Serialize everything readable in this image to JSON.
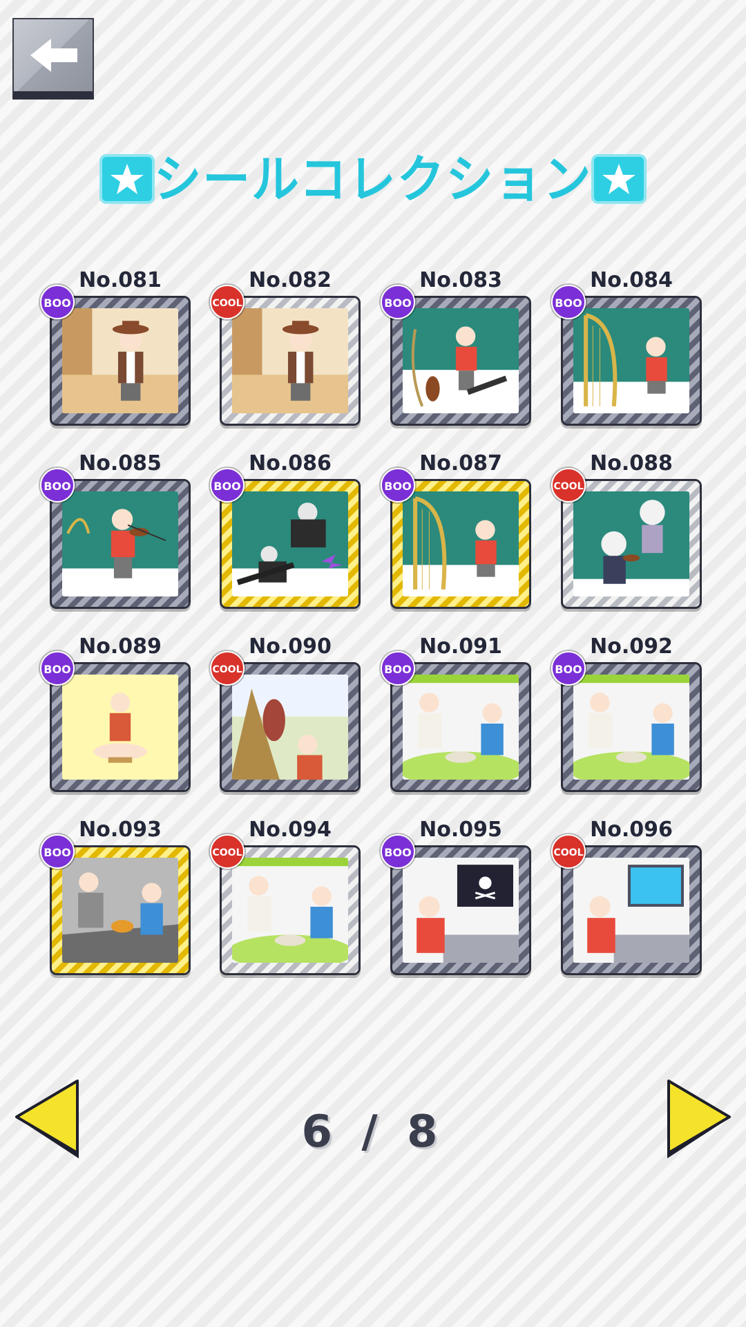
{
  "title": "シールコレクション",
  "icons": {
    "back": "back-arrow-icon",
    "title_deco": "star-sticker-icon",
    "prev": "triangle-left-icon",
    "next": "triangle-right-icon"
  },
  "colors": {
    "title": "#25c6dc",
    "boo_badge": "#7b2fd6",
    "cool_badge": "#d8322a",
    "arrow": "#f4e32a"
  },
  "stickers": [
    {
      "label": "No.081",
      "badge": "BOO",
      "frame": "gray",
      "scene": "cowboy"
    },
    {
      "label": "No.082",
      "badge": "COOL",
      "frame": "silver",
      "scene": "cowboy"
    },
    {
      "label": "No.083",
      "badge": "BOO",
      "frame": "gray",
      "scene": "music"
    },
    {
      "label": "No.084",
      "badge": "BOO",
      "frame": "gray",
      "scene": "harp"
    },
    {
      "label": "No.085",
      "badge": "BOO",
      "frame": "gray",
      "scene": "violin"
    },
    {
      "label": "No.086",
      "badge": "BOO",
      "frame": "gold",
      "scene": "rock"
    },
    {
      "label": "No.087",
      "badge": "BOO",
      "frame": "gold",
      "scene": "harp"
    },
    {
      "label": "No.088",
      "badge": "COOL",
      "frame": "silver",
      "scene": "classic"
    },
    {
      "label": "No.089",
      "badge": "BOO",
      "frame": "gray",
      "scene": "caveman"
    },
    {
      "label": "No.090",
      "badge": "COOL",
      "frame": "gray",
      "scene": "cavemeat"
    },
    {
      "label": "No.091",
      "badge": "BOO",
      "frame": "gray",
      "scene": "cooking"
    },
    {
      "label": "No.092",
      "badge": "BOO",
      "frame": "gray",
      "scene": "cooking"
    },
    {
      "label": "No.093",
      "badge": "BOO",
      "frame": "gold",
      "scene": "dinner"
    },
    {
      "label": "No.094",
      "badge": "COOL",
      "frame": "silver",
      "scene": "cooking"
    },
    {
      "label": "No.095",
      "badge": "BOO",
      "frame": "gray",
      "scene": "pirate"
    },
    {
      "label": "No.096",
      "badge": "COOL",
      "frame": "gray",
      "scene": "computer"
    }
  ],
  "pager": {
    "current": 6,
    "total": 8,
    "text": "6 / 8"
  }
}
